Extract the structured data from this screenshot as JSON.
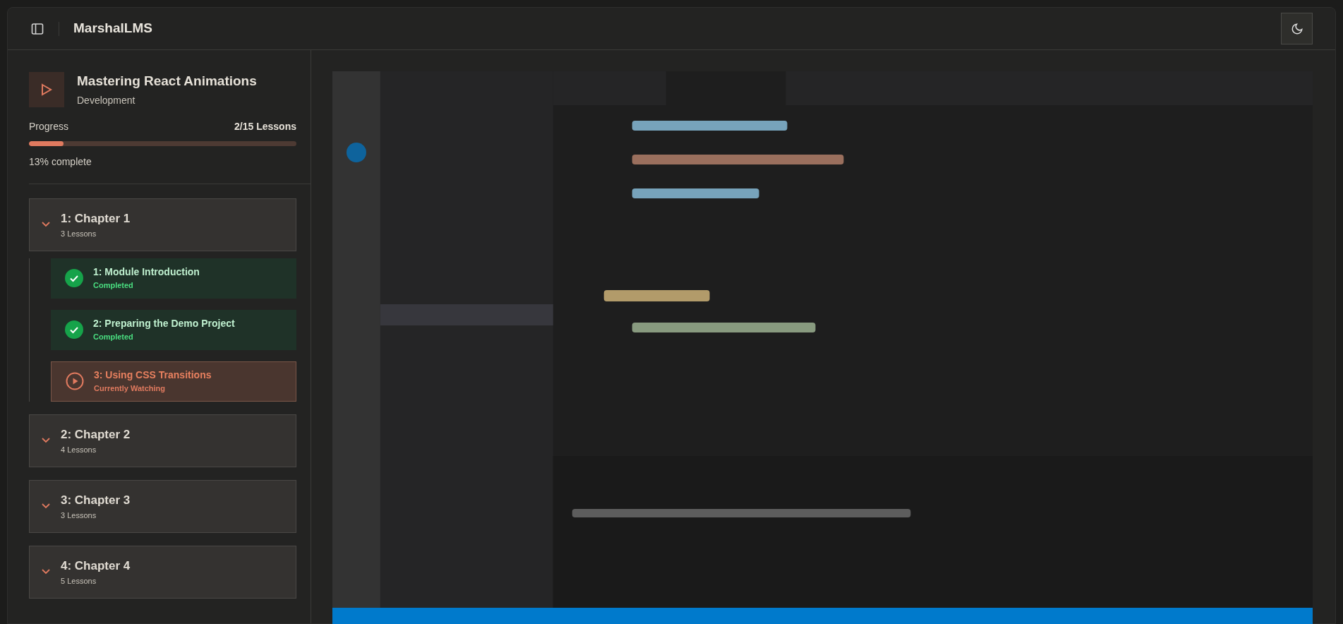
{
  "app": {
    "title": "MarshalLMS"
  },
  "course": {
    "title": "Mastering React Animations",
    "category": "Development",
    "progress_label": "Progress",
    "lessons_count": "2/15 Lessons",
    "level": 0.13,
    "percent": "13% complete"
  },
  "chapters": [
    {
      "title": "1: Chapter 1",
      "count": "3 Lessons",
      "expanded": true,
      "lessons": [
        {
          "title": "1: Module Introduction",
          "status": "Completed",
          "kind": "completed"
        },
        {
          "title": "2: Preparing the Demo Project",
          "status": "Completed",
          "kind": "completed"
        },
        {
          "title": "3: Using CSS Transitions",
          "status": "Currently Watching",
          "kind": "watching"
        }
      ]
    },
    {
      "title": "2: Chapter 2",
      "count": "4 Lessons",
      "expanded": false
    },
    {
      "title": "3: Chapter 3",
      "count": "3 Lessons",
      "expanded": false
    },
    {
      "title": "4: Chapter 4",
      "count": "5 Lessons",
      "expanded": false
    }
  ]
}
